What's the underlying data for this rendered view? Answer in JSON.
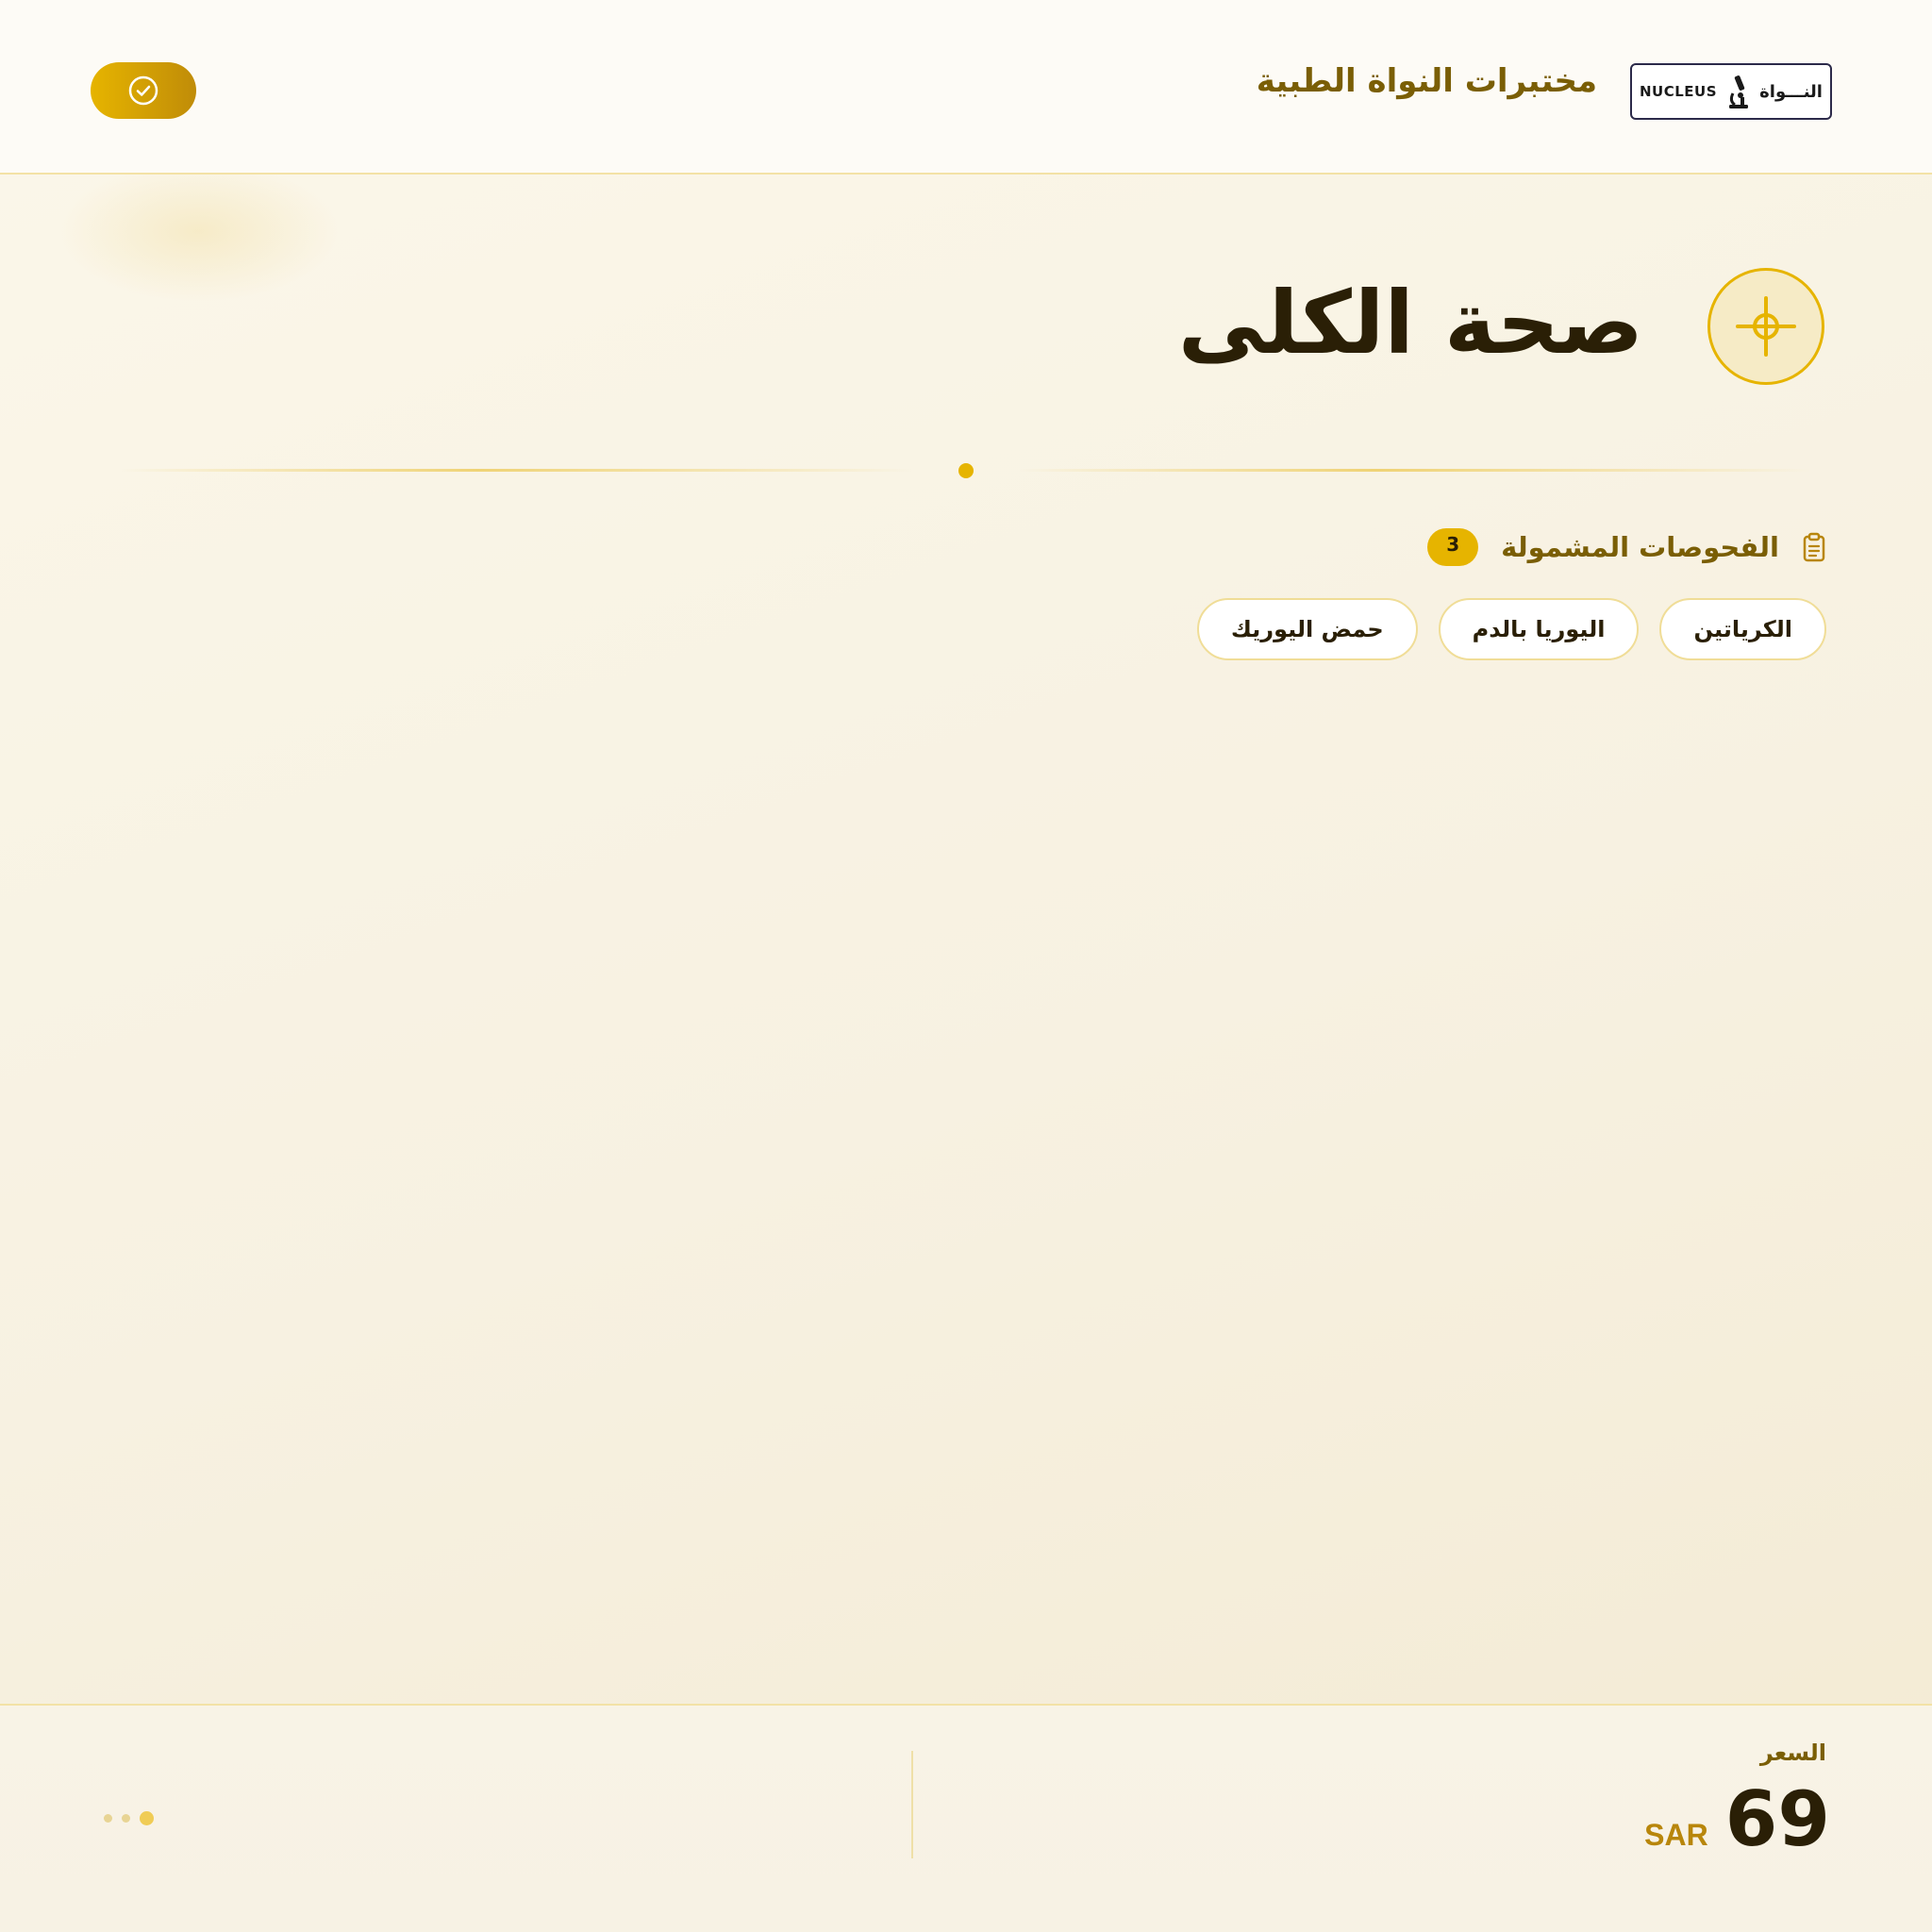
{
  "header": {
    "brand_name": "مختبرات النواة الطبية",
    "logo": {
      "text_en": "NUCLEUS",
      "text_ar": "النـــواة",
      "icon": "microscope-icon"
    },
    "verify_button": {
      "icon": "check-circle-icon"
    }
  },
  "package": {
    "title": "صحة الكلى",
    "icon": "crosshair-plus-icon"
  },
  "tests": {
    "title": "الفحوصات المشمولة",
    "count": "3",
    "icon": "clipboard-icon",
    "items": [
      {
        "label": "الكرياتين"
      },
      {
        "label": "اليوريا بالدم"
      },
      {
        "label": "حمض اليوريك"
      }
    ]
  },
  "footer": {
    "price_label": "السعر",
    "price_value": "69",
    "currency": "SAR",
    "pager": {
      "pages": 3,
      "active": 3
    }
  },
  "colors": {
    "accent": "#e6b400",
    "accent_dark": "#7a5e05",
    "text_dark": "#2a1f06",
    "background": "#f7f1e1",
    "chip_border": "#f0dd97"
  }
}
